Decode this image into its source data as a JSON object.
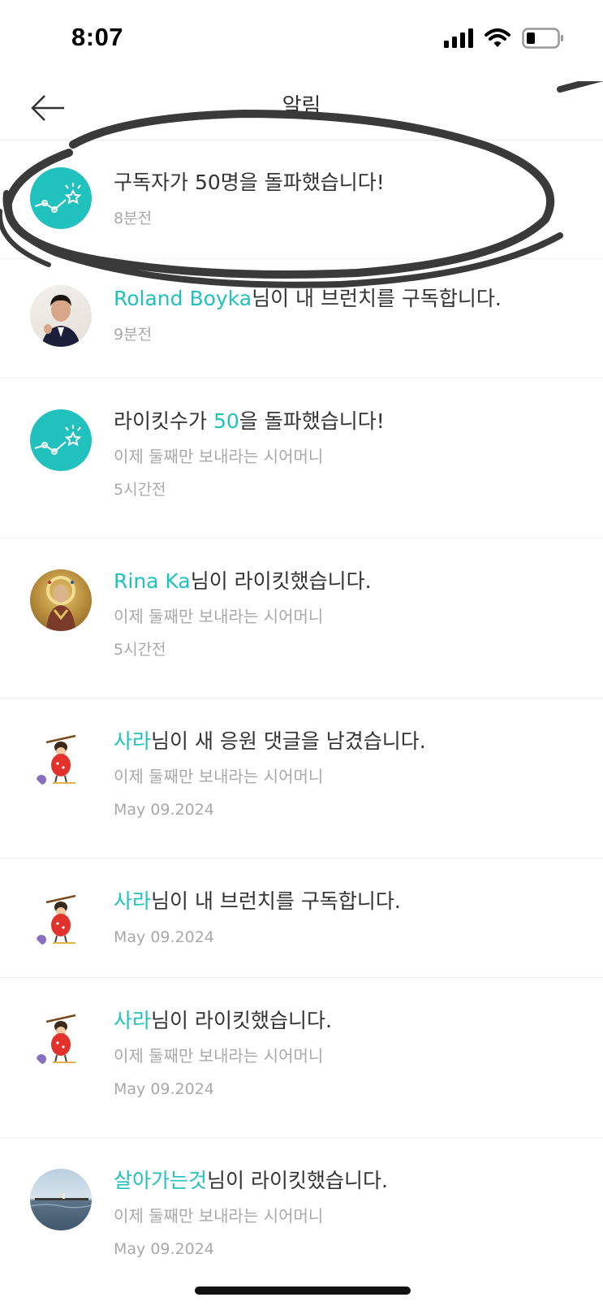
{
  "status_bar": {
    "time": "8:07",
    "icons": [
      "signal-icon",
      "wifi-icon",
      "battery-icon"
    ]
  },
  "header": {
    "title": "알림",
    "back_icon": "arrow-left-icon"
  },
  "colors": {
    "accent": "#21c1be",
    "text": "#333333",
    "muted": "#a9a9a9",
    "divider": "#eeeeee",
    "annotation": "#3a3a3a"
  },
  "notifications": [
    {
      "avatar": "chart-milestone-icon",
      "pre": "구독자가 ",
      "highlight": "",
      "post": "50명을 돌파했습니다!",
      "subtitle": "",
      "time": "8분전"
    },
    {
      "avatar": "user-photo-man",
      "pre": "",
      "highlight": "Roland Boyka",
      "post": "님이 내 브런치를 구독합니다.",
      "subtitle": "",
      "time": "9분전"
    },
    {
      "avatar": "chart-milestone-icon",
      "pre": "라이킷수가 ",
      "highlight": "50",
      "post": "을 돌파했습니다!",
      "subtitle": "이제 둘째만 보내라는 시어머니",
      "time": "5시간전"
    },
    {
      "avatar": "user-photo-mosaic",
      "pre": "",
      "highlight": "Rina Ka",
      "post": "님이 라이킷했습니다.",
      "subtitle": "이제 둘째만 보내라는 시어머니",
      "time": "5시간전"
    },
    {
      "avatar": "user-illustration",
      "pre": "",
      "highlight": "사라",
      "post": "님이 새 응원 댓글을 남겼습니다.",
      "subtitle": "이제 둘째만 보내라는 시어머니",
      "time": "May 09.2024"
    },
    {
      "avatar": "user-illustration",
      "pre": "",
      "highlight": "사라",
      "post": "님이 내 브런치를 구독합니다.",
      "subtitle": "",
      "time": "May 09.2024"
    },
    {
      "avatar": "user-illustration",
      "pre": "",
      "highlight": "사라",
      "post": "님이 라이킷했습니다.",
      "subtitle": "이제 둘째만 보내라는 시어머니",
      "time": "May 09.2024"
    },
    {
      "avatar": "user-photo-seaside",
      "pre": "",
      "highlight": "살아가는것",
      "post": "님이 라이킷했습니다.",
      "subtitle": "이제 둘째만 보내라는 시어머니",
      "time": "May 09.2024"
    }
  ]
}
